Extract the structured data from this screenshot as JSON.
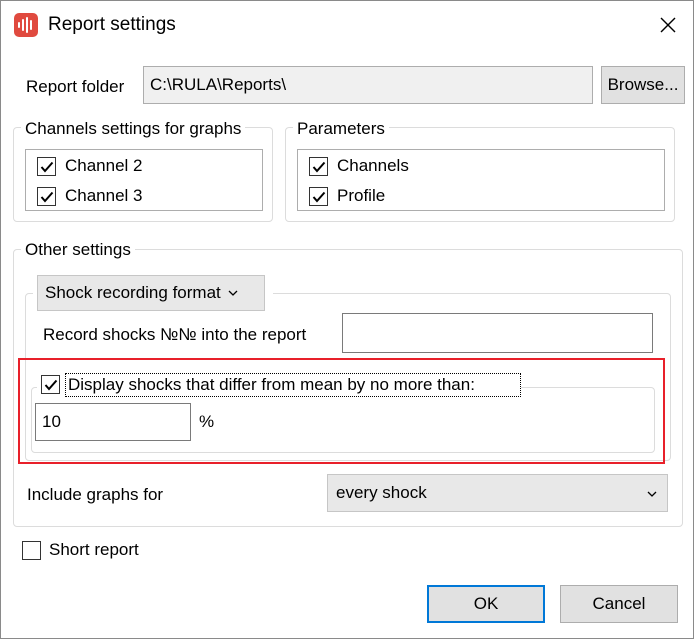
{
  "window": {
    "title": "Report settings"
  },
  "report_folder": {
    "label": "Report folder",
    "value": "C:\\RULA\\Reports\\",
    "browse_label": "Browse..."
  },
  "channels_group": {
    "title": "Channels settings for graphs",
    "items": [
      {
        "label": "Channel 2",
        "checked": true
      },
      {
        "label": "Channel 3",
        "checked": true
      }
    ]
  },
  "parameters_group": {
    "title": "Parameters",
    "items": [
      {
        "label": "Channels",
        "checked": true
      },
      {
        "label": "Profile",
        "checked": true
      }
    ]
  },
  "other_settings": {
    "title": "Other settings",
    "shock_format_label": "Shock recording format",
    "record_shocks_label": "Record shocks №№ into the report",
    "record_shocks_value": "",
    "display_shocks_label": "Display shocks that differ from mean by no more than:",
    "display_shocks_checked": true,
    "percent_value": "10",
    "percent_unit": "%",
    "include_graphs_label": "Include graphs for",
    "include_graphs_value": "every shock"
  },
  "short_report": {
    "label": "Short report",
    "checked": false
  },
  "buttons": {
    "ok": "OK",
    "cancel": "Cancel"
  },
  "colors": {
    "accent": "#0078d7",
    "highlight": "#e8202a",
    "app_icon": "#e04a3f"
  },
  "icons": {
    "app": "audio-waveform-icon",
    "close": "close-icon",
    "check": "checkmark-icon",
    "dropdown": "chevron-down-icon"
  }
}
